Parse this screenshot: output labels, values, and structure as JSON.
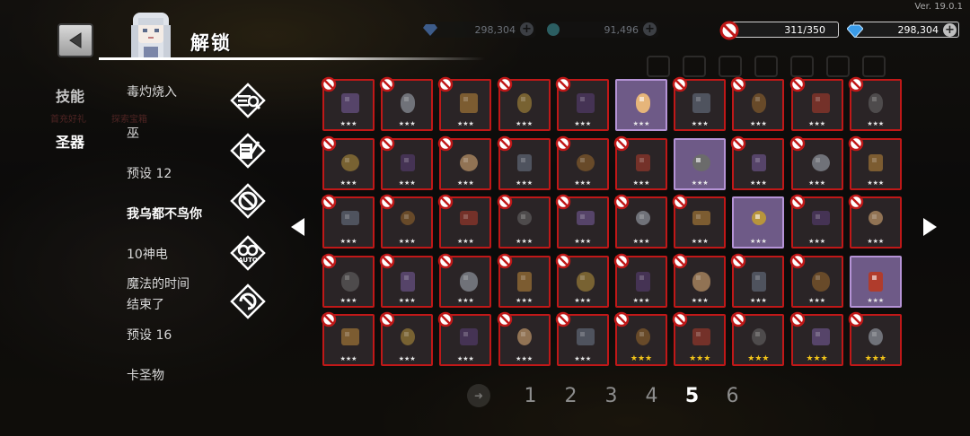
{
  "header": {
    "title": "解锁",
    "version": "Ver. 19.0.1"
  },
  "resources": [
    {
      "id": "gem-faded",
      "value": "298,304",
      "icon": "blue-gem-icon"
    },
    {
      "id": "orb-faded",
      "value": "91,496",
      "icon": "teal-orb-icon"
    },
    {
      "id": "relic-capacity",
      "value": "311/350",
      "icon": "no-sign-icon"
    },
    {
      "id": "gems",
      "value": "298,304",
      "icon": "blue-gem-icon"
    }
  ],
  "categories": [
    {
      "label": "技能",
      "active": false
    },
    {
      "label": "圣器",
      "active": true
    }
  ],
  "background_faded_text": [
    "首充好礼",
    "探索宝箱"
  ],
  "presets": [
    {
      "label": "毒灼烧入",
      "active": false
    },
    {
      "label": "巫",
      "active": false
    },
    {
      "label": "预设 12",
      "active": false
    },
    {
      "label": "我乌都不鸟你",
      "active": true
    },
    {
      "label": "10神电",
      "active": false
    },
    {
      "label": "魔法的时间结束了",
      "line1": "魔法的时间",
      "line2": "结束了",
      "active": false
    },
    {
      "label": "预设 16",
      "active": false
    },
    {
      "label": "卡圣物",
      "active": false
    }
  ],
  "side_icons": [
    "search-list-icon",
    "scroll-quill-icon",
    "no-cancel-icon",
    "auto-loop-icon",
    "refresh-cancel-icon"
  ],
  "relic_grid": {
    "rows": [
      [
        {
          "name": "purple-spellbook",
          "unlocked": false,
          "stars": "★★★"
        },
        {
          "name": "grey-stone",
          "unlocked": false,
          "stars": "★★★"
        },
        {
          "name": "small-die",
          "unlocked": false,
          "stars": "★★★"
        },
        {
          "name": "golden-chalice",
          "unlocked": false,
          "stars": "★★★"
        },
        {
          "name": "dark-tome",
          "unlocked": false,
          "stars": "★★★"
        },
        {
          "name": "pink-brain-bun",
          "unlocked": true,
          "stars": "★★★"
        },
        {
          "name": "syringe",
          "unlocked": false,
          "stars": "★★★"
        },
        {
          "name": "bronze-coin",
          "unlocked": false,
          "stars": "★★★"
        },
        {
          "name": "red-shield",
          "unlocked": false,
          "stars": "★★★"
        },
        {
          "name": "iron-cross",
          "unlocked": false,
          "stars": "★★★"
        }
      ],
      [
        {
          "name": "green-card",
          "unlocked": false,
          "stars": "★★★"
        },
        {
          "name": "dark-rifle",
          "unlocked": false,
          "stars": "★★★"
        },
        {
          "name": "fire-orb",
          "unlocked": false,
          "stars": "★★★"
        },
        {
          "name": "holy-scroll",
          "unlocked": false,
          "stars": "★★★"
        },
        {
          "name": "blue-cannon",
          "unlocked": false,
          "stars": "★★★"
        },
        {
          "name": "red-sprout",
          "unlocked": false,
          "stars": "★★★"
        },
        {
          "name": "red-egg",
          "unlocked": true,
          "stars": "★★★"
        },
        {
          "name": "first-aid-kit",
          "unlocked": false,
          "stars": "★★★"
        },
        {
          "name": "green-mask",
          "unlocked": false,
          "stars": "★★★"
        },
        {
          "name": "bone-spear",
          "unlocked": false,
          "stars": "★★★"
        }
      ],
      [
        {
          "name": "crescent-moon",
          "unlocked": false,
          "stars": "★★★"
        },
        {
          "name": "bread-loaf",
          "unlocked": false,
          "stars": "★★★"
        },
        {
          "name": "green-cloak",
          "unlocked": false,
          "stars": "★★★"
        },
        {
          "name": "black-dagger",
          "unlocked": false,
          "stars": "★★★"
        },
        {
          "name": "blue-dragon",
          "unlocked": false,
          "stars": "★★★"
        },
        {
          "name": "gold-nugget",
          "unlocked": false,
          "stars": "★★★"
        },
        {
          "name": "storm-cloud",
          "unlocked": false,
          "stars": "★★★"
        },
        {
          "name": "bandaged-box",
          "unlocked": true,
          "stars": "★★★"
        },
        {
          "name": "purple-bat",
          "unlocked": false,
          "stars": "★★★"
        },
        {
          "name": "bronze-medal",
          "unlocked": false,
          "stars": "★★★"
        }
      ],
      [
        {
          "name": "longbow",
          "unlocked": false,
          "stars": "★★★"
        },
        {
          "name": "dark-bird",
          "unlocked": false,
          "stars": "★★★"
        },
        {
          "name": "treasure-chest",
          "unlocked": false,
          "stars": "★★★"
        },
        {
          "name": "purple-glove",
          "unlocked": false,
          "stars": "★★★"
        },
        {
          "name": "bronze-gear",
          "unlocked": false,
          "stars": "★★★"
        },
        {
          "name": "coin-pouch",
          "unlocked": false,
          "stars": "★★★"
        },
        {
          "name": "crossed-arrows",
          "unlocked": false,
          "stars": "★★★"
        },
        {
          "name": "black-feather",
          "unlocked": false,
          "stars": "★★★"
        },
        {
          "name": "cake-slice",
          "unlocked": false,
          "stars": "★★★"
        },
        {
          "name": "golden-cube",
          "unlocked": true,
          "stars": "★★★"
        }
      ],
      [
        {
          "name": "ankh",
          "unlocked": false,
          "stars": "★★★"
        },
        {
          "name": "sun-hat",
          "unlocked": false,
          "stars": "★★★"
        },
        {
          "name": "purple-blade",
          "unlocked": false,
          "stars": "★★★"
        },
        {
          "name": "old-letter",
          "unlocked": false,
          "stars": "★★★"
        },
        {
          "name": "white-feather",
          "unlocked": false,
          "stars": "★★★"
        },
        {
          "name": "tattered-map",
          "unlocked": false,
          "stars": "★★★",
          "gold": true
        },
        {
          "name": "twisted-branch",
          "unlocked": false,
          "stars": "★★★",
          "gold": true
        },
        {
          "name": "black-skull",
          "unlocked": false,
          "stars": "★★★",
          "gold": true
        },
        {
          "name": "dark-gauntlet",
          "unlocked": false,
          "stars": "★★★",
          "gold": true
        },
        {
          "name": "red-ring",
          "unlocked": false,
          "stars": "★★★",
          "gold": true
        }
      ]
    ]
  },
  "pagination": {
    "pages": [
      "1",
      "2",
      "3",
      "4",
      "5",
      "6"
    ],
    "current": "5"
  },
  "colors": {
    "locked_border": "#c01818",
    "unlocked_border": "#b593d6",
    "unlocked_fill": "#6e5a87",
    "gold_star": "#f2c419"
  }
}
